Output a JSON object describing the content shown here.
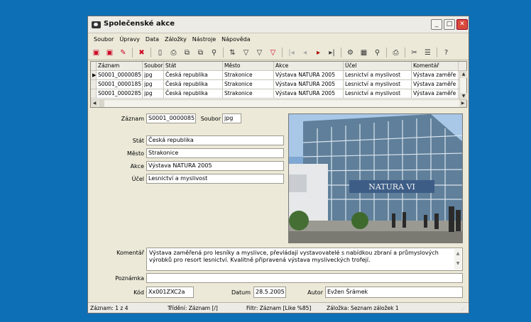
{
  "window": {
    "title": "Společenské akce"
  },
  "menu": [
    "Soubor",
    "Úpravy",
    "Data",
    "Záložky",
    "Nástroje",
    "Nápověda"
  ],
  "grid": {
    "columns": [
      "Záznam",
      "Soubor",
      "Stát",
      "Město",
      "Akce",
      "Účel",
      "Komentář"
    ],
    "rows": [
      [
        "S0001_0000085",
        "jpg",
        "Česká republika",
        "Strakonice",
        "Výstava NATURA 2005",
        "Lesnictví a myslivost",
        "Výstava zaměře"
      ],
      [
        "S0001_0000185",
        "jpg",
        "Česká republika",
        "Strakonice",
        "Výstava NATURA 2005",
        "Lesnictví a myslivost",
        "Výstava zaměře"
      ],
      [
        "S0001_0000285",
        "jpg",
        "Česká republika",
        "Strakonice",
        "Výstava NATURA 2005",
        "Lesnictví a myslivost",
        "Výstava zaměře"
      ]
    ]
  },
  "form": {
    "zaznam_label": "Záznam",
    "zaznam": "S0001_0000085",
    "soubor_label": "Soubor",
    "soubor": "jpg",
    "stat_label": "Stát",
    "stat": "Česká republika",
    "mesto_label": "Město",
    "mesto": "Strakonice",
    "akce_label": "Akce",
    "akce": "Výstava NATURA 2005",
    "ucel_label": "Účel",
    "ucel": "Lesnictví a myslivost",
    "komentar_label": "Komentář",
    "komentar": "Výstava zaměřená pro lesníky a myslivce, převládají vystavovatelé s nabídkou zbraní a průmyslových výrobků pro resort lesnictví. Kvalitně připravená výstava mysliveckých trofejí.",
    "poznamka_label": "Poznámka",
    "poznamka": "",
    "kod_label": "Kód",
    "kod": "Xx001ZXC2a",
    "datum_label": "Datum",
    "datum": "28.5.2005",
    "autor_label": "Autor",
    "autor": "Evžen Šrámek"
  },
  "photo": {
    "sign_text": "NATURA VI"
  },
  "status": {
    "zaznam": "Záznam: 1 z 4",
    "trideni": "Třídění: Záznam [/]",
    "filtr": "Filtr: Záznam [Like %85]",
    "zalozka": "Záložka: Seznam záložek 1"
  }
}
